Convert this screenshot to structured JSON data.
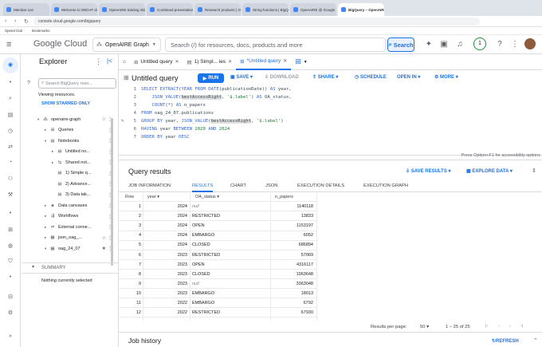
{
  "browser": {
    "tabs": [
      "Member List",
      "Welcome to SNO-IF docum",
      "OpenAIRE training slides",
      "Combined presentation",
      "Research products | Open",
      "String functions | BigQue",
      "OpenAIRE @ Google",
      "BigQuery – OpenAIRE Gra"
    ],
    "active_tab": 7,
    "url": "console.cloud.google.com/bigquery",
    "bookmarks": [
      "Speed Dial",
      "Bookmarks"
    ]
  },
  "header": {
    "product": "Google Cloud",
    "project": "OpenAIRE Graph",
    "search_placeholder": "Search (/) for resources, docs, products and more",
    "search_button": "Search",
    "badge": "1"
  },
  "explorer": {
    "title": "Explorer",
    "search_placeholder": "Search BigQuery reso...",
    "viewing": "Viewing resources.",
    "show_starred": "SHOW STARRED ONLY",
    "tree": [
      {
        "label": "openaire-graph",
        "indent": 0,
        "icon": "project",
        "arrow": "▾"
      },
      {
        "label": "Queries",
        "indent": 1,
        "icon": "query",
        "arrow": "▸"
      },
      {
        "label": "Notebooks",
        "indent": 1,
        "icon": "notebook",
        "arrow": "▾"
      },
      {
        "label": "Untitled no...",
        "indent": 2,
        "icon": "notebook",
        "arrow": "▸"
      },
      {
        "label": "Shared not...",
        "indent": 2,
        "icon": "shared",
        "arrow": "▸"
      },
      {
        "label": "1) Simple q...",
        "indent": 2,
        "icon": "notebook",
        "arrow": ""
      },
      {
        "label": "2) Advance...",
        "indent": 2,
        "icon": "notebook",
        "arrow": ""
      },
      {
        "label": "3) Data tak...",
        "indent": 2,
        "icon": "notebook",
        "arrow": ""
      },
      {
        "label": "Data canvases",
        "indent": 1,
        "icon": "canvas",
        "arrow": "▸"
      },
      {
        "label": "Workflows",
        "indent": 1,
        "icon": "workflow",
        "arrow": "▸"
      },
      {
        "label": "External conne...",
        "indent": 1,
        "icon": "connection",
        "arrow": "▸"
      },
      {
        "label": "json_oag_...",
        "indent": 1,
        "icon": "dataset",
        "arrow": "▸"
      },
      {
        "label": "oag_24_07",
        "indent": 1,
        "icon": "dataset",
        "arrow": "▾"
      }
    ],
    "summary": "SUMMARY",
    "nothing_selected": "Nothing currently selected"
  },
  "editor": {
    "tabs": [
      {
        "label": "Untitled query",
        "active": false
      },
      {
        "label": "1) Simpl... ies",
        "active": false
      },
      {
        "label": "*Untitled query",
        "active": true
      }
    ],
    "title": "Untitled query",
    "run": "RUN",
    "save": "SAVE",
    "download": "DOWNLOAD",
    "share": "SHARE",
    "schedule": "SCHEDULE",
    "open_in": "OPEN IN",
    "more": "MORE",
    "accessibility_note": "Press Option+F1 for accessibility options"
  },
  "results": {
    "title": "Query results",
    "save_results": "SAVE RESULTS",
    "explore_data": "EXPLORE DATA",
    "tabs": [
      "JOB INFORMATION",
      "RESULTS",
      "CHART",
      "JSON",
      "EXECUTION DETAILS",
      "EXECUTION GRAPH"
    ],
    "active_tab": 1,
    "columns": [
      "Row",
      "year",
      "OA_status",
      "n_papers"
    ],
    "rows": [
      [
        "1",
        "2024",
        "null",
        "1140118"
      ],
      [
        "2",
        "2024",
        "RESTRICTED",
        "13833"
      ],
      [
        "3",
        "2024",
        "OPEN",
        "1153197"
      ],
      [
        "4",
        "2024",
        "EMBARGO",
        "6052"
      ],
      [
        "5",
        "2024",
        "CLOSED",
        "686894"
      ],
      [
        "6",
        "2023",
        "RESTRICTED",
        "57069"
      ],
      [
        "7",
        "2023",
        "OPEN",
        "4316117"
      ],
      [
        "8",
        "2023",
        "CLOSED",
        "1963648"
      ],
      [
        "9",
        "2023",
        "null",
        "3363048"
      ],
      [
        "10",
        "2023",
        "EMBARGO",
        "18013"
      ],
      [
        "11",
        "2022",
        "EMBARGO",
        "6792"
      ],
      [
        "12",
        "2022",
        "RESTRICTED",
        "67930"
      ]
    ],
    "results_per_page_label": "Results per page:",
    "results_per_page": "50",
    "range": "1 – 25 of 25"
  },
  "job_history": {
    "title": "Job history",
    "refresh": "REFRESH"
  }
}
